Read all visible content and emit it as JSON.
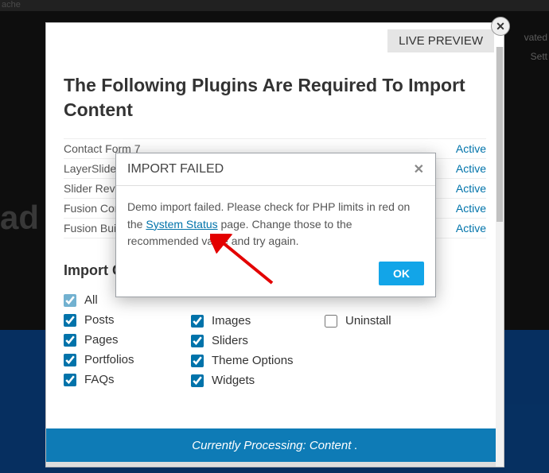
{
  "bg": {
    "top_label": "ache",
    "right1": "vated",
    "right2": "Sett"
  },
  "modal": {
    "live_preview": "LIVE PREVIEW",
    "title": "The Following Plugins Are Required To Import Content",
    "plugins": [
      {
        "name": "Contact Form 7",
        "status": "Active"
      },
      {
        "name": "LayerSlider WP",
        "status": "Active"
      },
      {
        "name": "Slider Revolution",
        "status": "Active"
      },
      {
        "name": "Fusion Core",
        "status": "Active"
      },
      {
        "name": "Fusion Builder",
        "status": "Active"
      }
    ],
    "import_title": "Import Content",
    "checkboxes_col1": [
      {
        "label": "All",
        "checked": true,
        "all": true
      },
      {
        "label": "Posts",
        "checked": true
      },
      {
        "label": "Pages",
        "checked": true
      },
      {
        "label": "Portfolios",
        "checked": true
      },
      {
        "label": "FAQs",
        "checked": true
      }
    ],
    "checkboxes_col2": [
      {
        "label": "Images",
        "checked": true
      },
      {
        "label": "Sliders",
        "checked": true
      },
      {
        "label": "Theme Options",
        "checked": true
      },
      {
        "label": "Widgets",
        "checked": true
      }
    ],
    "checkboxes_col3": [
      {
        "label": "Uninstall",
        "checked": false
      }
    ],
    "footer": "Currently Processing: Content  ."
  },
  "inner": {
    "title": "IMPORT FAILED",
    "body_before": "Demo import failed. Please check for PHP limits in red on the ",
    "link": "System Status",
    "body_after": " page. Change those to the recommended value and try again.",
    "ok": "OK"
  }
}
